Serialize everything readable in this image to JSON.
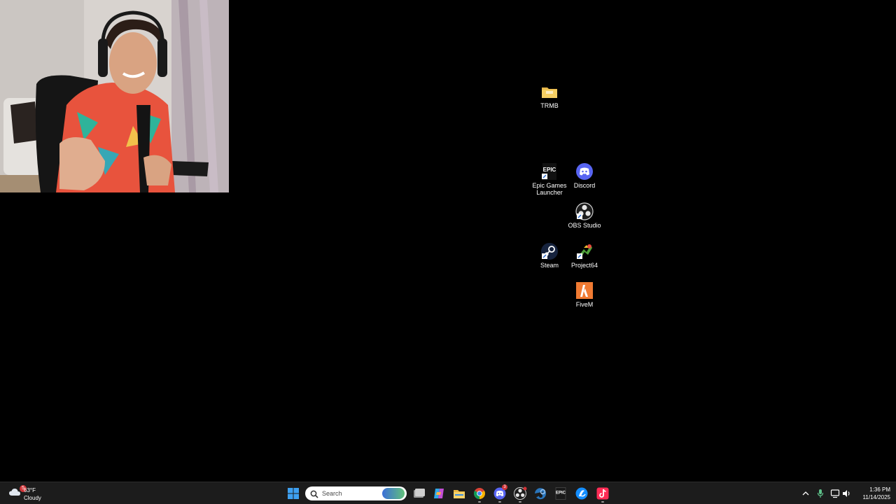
{
  "desktop": {
    "icons": [
      {
        "label": "TRMB",
        "icon": "folder-icon"
      },
      {
        "label": "Epic Games Launcher",
        "icon": "epic-games-icon",
        "glyph_text": "EPIC"
      },
      {
        "label": "Discord",
        "icon": "discord-icon"
      },
      {
        "label": "OBS Studio",
        "icon": "obs-icon"
      },
      {
        "label": "Steam",
        "icon": "steam-icon"
      },
      {
        "label": "Project64",
        "icon": "project64-icon"
      },
      {
        "label": "FiveM",
        "icon": "fivem-icon"
      }
    ]
  },
  "webcam": {
    "description_icon": "webcam-overlay"
  },
  "taskbar": {
    "weather": {
      "temp": "63°F",
      "condition": "Cloudy",
      "badge": "5",
      "icon": "cloud-icon"
    },
    "search": {
      "placeholder": "Search"
    },
    "apps": [
      {
        "name": "start-button",
        "icon": "windows-icon"
      },
      {
        "name": "task-view",
        "icon": "task-view-icon"
      },
      {
        "name": "copilot",
        "icon": "copilot-icon"
      },
      {
        "name": "file-explorer",
        "icon": "folder-icon"
      },
      {
        "name": "chrome",
        "icon": "chrome-icon"
      },
      {
        "name": "discord",
        "icon": "discord-icon",
        "badge": "3"
      },
      {
        "name": "obs",
        "icon": "obs-icon"
      },
      {
        "name": "steam",
        "icon": "steam-icon"
      },
      {
        "name": "epic",
        "icon": "epic-games-icon",
        "glyph_text": "EPIC"
      },
      {
        "name": "battlenet",
        "icon": "battlenet-icon"
      },
      {
        "name": "tiktok",
        "icon": "tiktok-icon"
      }
    ],
    "tray": {
      "time": "1:36 PM",
      "date": "11/14/2025"
    }
  },
  "colors": {
    "desktop_bg": "#000000",
    "taskbar_bg": "#1c1c1c",
    "accent": "#0078d4",
    "badge": "#d13438"
  }
}
